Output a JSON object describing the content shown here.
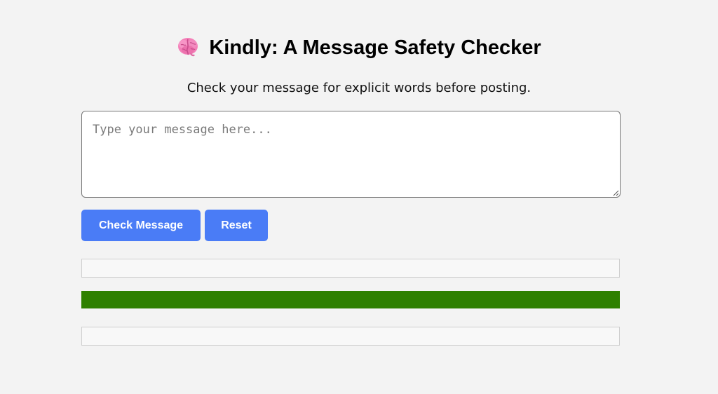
{
  "header": {
    "icon": "brain-icon",
    "title": "Kindly: A Message Safety Checker",
    "subtitle": "Check your message for explicit words before posting."
  },
  "message": {
    "value": "",
    "placeholder": "Type your message here..."
  },
  "actions": {
    "check_label": "Check Message",
    "reset_label": "Reset"
  },
  "results": {
    "top_text": "",
    "status_text": "",
    "bottom_text": ""
  },
  "colors": {
    "accent": "#4a7cf6",
    "status_safe": "#2e8000",
    "background": "#f3f3f3",
    "panel_border": "#cfcfcf"
  }
}
